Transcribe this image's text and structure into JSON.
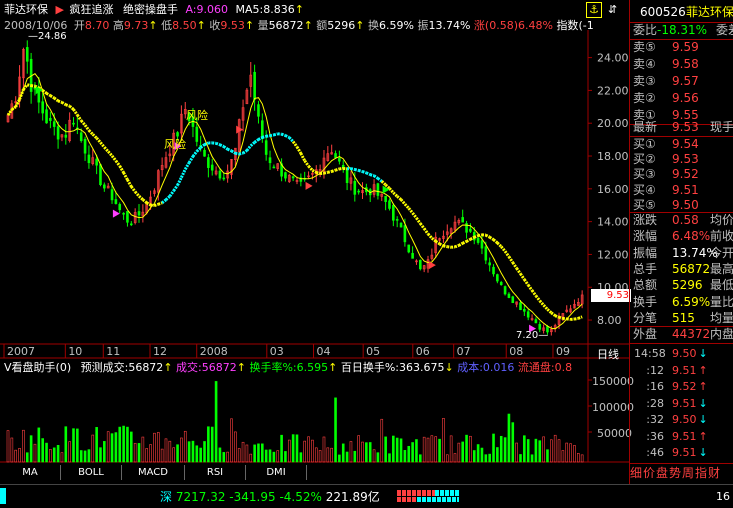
{
  "header": {
    "stock_name": "菲达环保",
    "play_icon": "triangle-right-icon",
    "menu1": "疯狂追涨",
    "menu2": "绝密操盘手",
    "a_text": "A:9.060",
    "ma5_text": "MA5:8.836"
  },
  "info": {
    "date": "2008/10/06",
    "open_label": "开",
    "open": "8.70",
    "high_label": "高",
    "high": "9.73",
    "low_label": "低",
    "low": "8.50",
    "close_label": "收",
    "close": "9.53",
    "vol_label": "量",
    "vol": "56872",
    "amt_label": "额",
    "amt": "5296",
    "turn_label": "换",
    "turn": "6.59%",
    "amp_label": "振",
    "amp": "13.74%",
    "chg_label": "涨",
    "chg": "(0.58)",
    "pct": "6.48%",
    "index_label": "指数",
    "index_tail": "(-1"
  },
  "chart_data": {
    "type": "candlestick",
    "y_ticks": [
      "24.00",
      "22.00",
      "20.00",
      "18.00",
      "16.00",
      "14.00",
      "12.00",
      "10.00",
      "8.00"
    ],
    "ylim": [
      6.6,
      25.5
    ],
    "x_ticks": [
      "2007",
      "10",
      "11",
      "12",
      "2008",
      "03",
      "04",
      "05",
      "06",
      "07",
      "08",
      "09"
    ],
    "x_tick_frac": [
      0.0,
      0.105,
      0.17,
      0.25,
      0.33,
      0.45,
      0.53,
      0.615,
      0.7,
      0.77,
      0.86,
      0.94
    ],
    "price_path": [
      20.5,
      21.8,
      24.86,
      22,
      21,
      20,
      19.5,
      19.2,
      20.5,
      19,
      18,
      17,
      16,
      15.5,
      14.5,
      14,
      14.3,
      15,
      16,
      17.5,
      18.5,
      19.5,
      21,
      19.5,
      18,
      17.5,
      17,
      17,
      18,
      21,
      23,
      20,
      18,
      17.5,
      17,
      16.5,
      16,
      16.5,
      17,
      18,
      18.5,
      17.5,
      16.5,
      16,
      15.8,
      16,
      15.5,
      15,
      14,
      13,
      12,
      11,
      11.5,
      13,
      13.5,
      14,
      13.8,
      13.5,
      13,
      12,
      11,
      10,
      9.5,
      9,
      8.5,
      8,
      7.5,
      7.2,
      8,
      8.5,
      9.0,
      9.53
    ],
    "high_label": "24.86",
    "low_label": "7.20",
    "current_price": "9.53",
    "annotations": [
      "风险",
      "风险"
    ],
    "period": "日线"
  },
  "volume_header": {
    "title": "V看盘助手(0)",
    "pred_label": "预测成交",
    "pred_val": ":56872",
    "chengjiao_label": "成交",
    "chengjiao_val": ":56872",
    "turnover_label": "换手率%",
    "turnover_val": ":6.595",
    "hundred_label": "百日换手%",
    "hundred_val": ":363.675",
    "cost_label": "成本",
    "cost_val": ":0.016",
    "flow_label": "流通盘",
    "flow_val": ":0.8"
  },
  "volume_axis": [
    "150000",
    "100000",
    "50000"
  ],
  "tabs": [
    "MA",
    "BOLL",
    "MACD",
    "RSI",
    "DMI"
  ],
  "quote": {
    "code": "600526",
    "name": "菲达环保",
    "weibi_label": "委比",
    "weibi_val": "-18.31%",
    "weicha_label": "委差",
    "asks": [
      {
        "label": "卖⑤",
        "price": "9.59"
      },
      {
        "label": "卖④",
        "price": "9.58"
      },
      {
        "label": "卖③",
        "price": "9.57"
      },
      {
        "label": "卖②",
        "price": "9.56"
      },
      {
        "label": "卖①",
        "price": "9.55"
      }
    ],
    "last_label": "最新",
    "last_price": "9.53",
    "last_tail": "现手",
    "bids": [
      {
        "label": "买①",
        "price": "9.54"
      },
      {
        "label": "买②",
        "price": "9.53"
      },
      {
        "label": "买③",
        "price": "9.52"
      },
      {
        "label": "买④",
        "price": "9.51"
      },
      {
        "label": "买⑤",
        "price": "9.50"
      }
    ],
    "stats": [
      {
        "label": "涨跌",
        "val": "0.58",
        "tail": "均价",
        "color": "#ff4040"
      },
      {
        "label": "涨幅",
        "val": "6.48%",
        "tail": "前收",
        "color": "#ff4040"
      },
      {
        "label": "振幅",
        "val": "13.74%",
        "tail": "今开",
        "color": "#ffffff"
      },
      {
        "label": "总手",
        "val": "56872",
        "tail": "最高",
        "color": "#ffff00"
      },
      {
        "label": "总额",
        "val": "5296",
        "tail": "最低",
        "color": "#ffff00"
      },
      {
        "label": "换手",
        "val": "6.59%",
        "tail": "量比",
        "color": "#ffff00"
      },
      {
        "label": "分笔",
        "val": "515",
        "tail": "均量",
        "color": "#ffff00"
      }
    ],
    "outer_label": "外盘",
    "outer_val": "44372",
    "inner_label": "内盘"
  },
  "ticks": [
    {
      "time": "14:58",
      "price": "9.50",
      "dir": "down"
    },
    {
      "time": ":12",
      "price": "9.51",
      "dir": "up"
    },
    {
      "time": ":16",
      "price": "9.52",
      "dir": "up"
    },
    {
      "time": ":28",
      "price": "9.51",
      "dir": "down"
    },
    {
      "time": ":32",
      "price": "9.50",
      "dir": "down"
    },
    {
      "time": ":36",
      "price": "9.51",
      "dir": "up"
    },
    {
      "time": ":46",
      "price": "9.51",
      "dir": "down"
    }
  ],
  "bottom_tabs": "细价盘势周指财",
  "status": {
    "market": "深",
    "index": "7217.32",
    "change": "-341.95",
    "pct": "-4.52%",
    "amount": "221.89亿",
    "right_num": "16"
  },
  "colors": {
    "up": "#ff4040",
    "down": "#00ff00",
    "ma_yellow": "#ffff00",
    "ma_cyan": "#00ffff",
    "border": "#a00000"
  }
}
